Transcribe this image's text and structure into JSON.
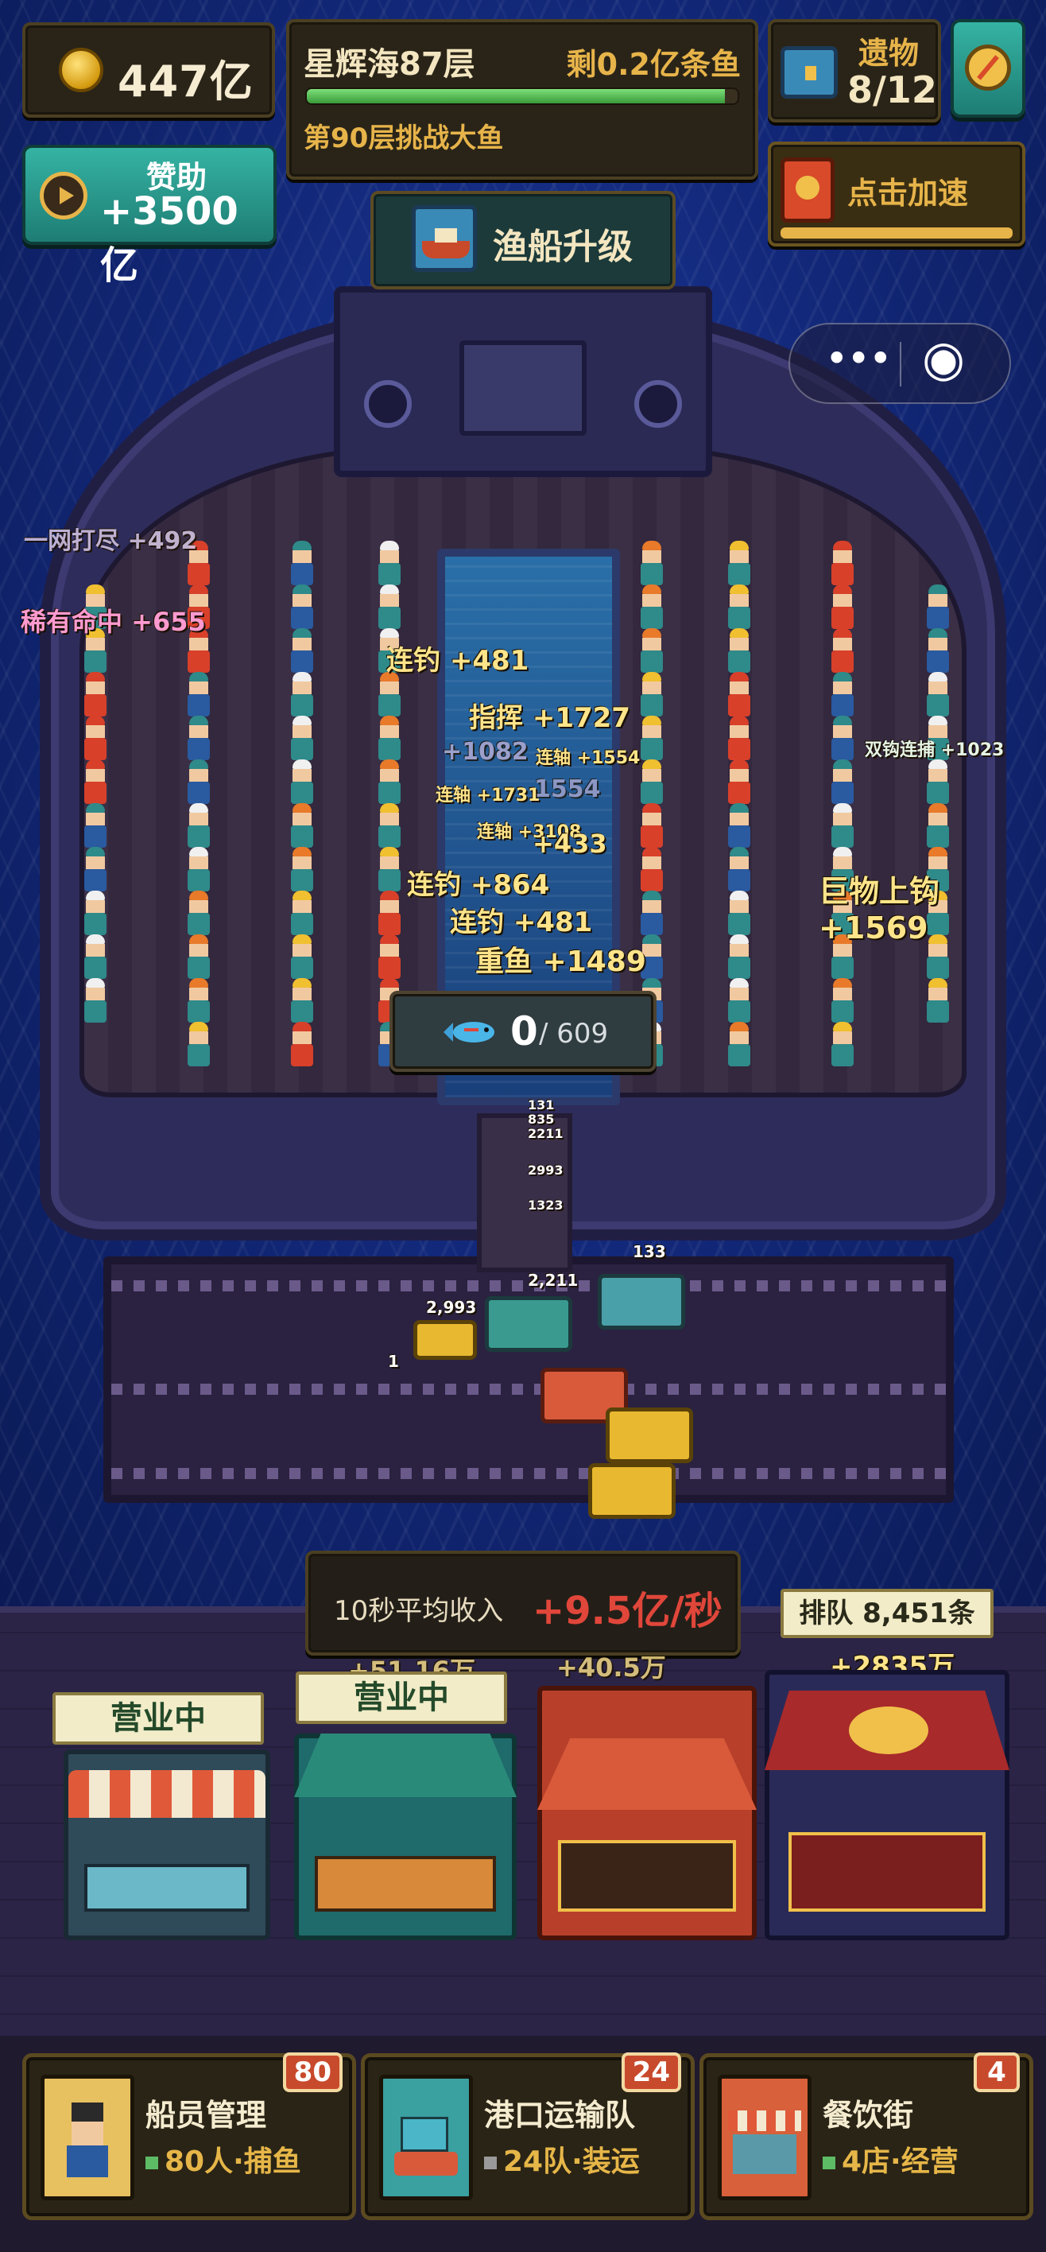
{
  "currency": {
    "amount": "447亿",
    "icon": "gold-coin-icon"
  },
  "level": {
    "title": "星辉海87层",
    "remaining": "剩0.2亿条鱼",
    "progress": 0.97,
    "challenge": "第90层挑战大鱼"
  },
  "relics": {
    "label": "遗物",
    "count": "8/12"
  },
  "sponsor": {
    "label": "赞助",
    "value": "+3500亿"
  },
  "speedup": {
    "label": "点击加速"
  },
  "ship_upgrade": {
    "label": "渔船升级"
  },
  "capsule": {
    "more": "•••",
    "target": "◉"
  },
  "catch_counter": {
    "current": "0",
    "total": "/ 609"
  },
  "floating_text": {
    "left1": "一网打尽 +492",
    "left2": "稀有命中 +655",
    "f1": "连钓 +481",
    "f2": "指挥 +1727",
    "f3": "+1082",
    "f4": "连轴 +1554",
    "f5": "连轴 +1731",
    "f6": "1554",
    "f7": "连轴 +3108",
    "f8": "+433",
    "f9": "连钓 +864",
    "f10": "连钓 +481",
    "f11": "重鱼 +1489",
    "right1": "双钩连捕 +1023",
    "right2": "巨物上钩 +1569"
  },
  "dock_labels": {
    "d1": "131",
    "d2": "835",
    "d3": "2211",
    "d4": "2993",
    "d5": "1323",
    "d6": "2,211",
    "d7": "133",
    "d8": "2,993",
    "d9": "1"
  },
  "income": {
    "label": "10秒平均收入",
    "value": "+9.5亿/秒"
  },
  "queue": {
    "label": "排队 8,451条",
    "gain": "+2835万"
  },
  "shops": [
    {
      "status": "营业中"
    },
    {
      "status": "营业中",
      "note": "+51.16万"
    },
    {
      "note": "+40.5万"
    }
  ],
  "bottom_cards": [
    {
      "title": "船员管理",
      "sub": "80人·捕鱼",
      "badge": "80"
    },
    {
      "title": "港口运输队",
      "sub": "24队·装运",
      "badge": "24"
    },
    {
      "title": "餐饮街",
      "sub": "4店·经营",
      "badge": "4"
    }
  ],
  "colors": {
    "gold": "#e7b44a",
    "teal": "#35b3a3",
    "ocean": "#12287a",
    "income_red": "#e0463a"
  }
}
